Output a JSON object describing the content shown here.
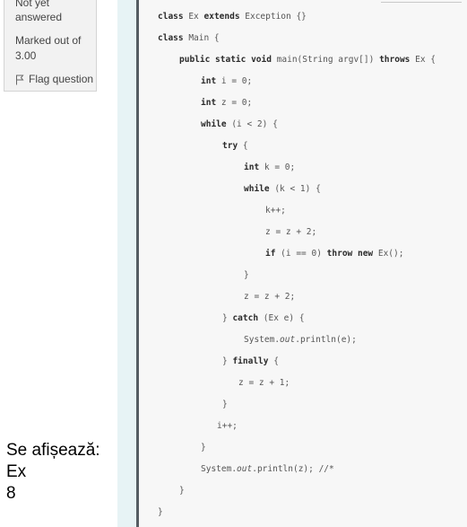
{
  "sidebar": {
    "status_line1": "Not yet",
    "status_line2": "answered",
    "marked_line1": "Marked out of",
    "marked_line2": "3.00",
    "flag_label": "Flag question",
    "flag_icon": "flag-icon"
  },
  "answer": {
    "line1": "Se afișează:",
    "line2": "Ex",
    "line3": "8"
  },
  "code": {
    "lines": [
      [
        {
          "t": "class",
          "k": 1
        },
        {
          "t": " Ex "
        },
        {
          "t": "extends",
          "k": 1
        },
        {
          "t": " Exception {}"
        }
      ],
      [
        {
          "t": "class",
          "k": 1
        },
        {
          "t": " Main {"
        }
      ],
      [
        {
          "t": "public static void",
          "k": 1
        },
        {
          "t": " main(String argv[]) "
        },
        {
          "t": "throws",
          "k": 1
        },
        {
          "t": " Ex {"
        }
      ],
      [
        {
          "t": "int",
          "k": 1
        },
        {
          "t": " i = 0;"
        }
      ],
      [
        {
          "t": "int",
          "k": 1
        },
        {
          "t": " z = 0;"
        }
      ],
      [
        {
          "t": "while",
          "k": 1
        },
        {
          "t": " (i < 2) {"
        }
      ],
      [
        {
          "t": "try",
          "k": 1
        },
        {
          "t": " {"
        }
      ],
      [
        {
          "t": "int",
          "k": 1
        },
        {
          "t": " k = 0;"
        }
      ],
      [
        {
          "t": "while",
          "k": 1
        },
        {
          "t": " (k < 1) {"
        }
      ],
      [
        {
          "t": "k++;"
        }
      ],
      [
        {
          "t": "z = z + 2;"
        }
      ],
      [
        {
          "t": "if",
          "k": 1
        },
        {
          "t": " (i == 0) "
        },
        {
          "t": "throw new",
          "k": 1
        },
        {
          "t": " Ex();"
        }
      ],
      [
        {
          "t": "}"
        }
      ],
      [
        {
          "t": "z = z + 2;"
        }
      ],
      [
        {
          "t": "} "
        },
        {
          "t": "catch",
          "k": 1
        },
        {
          "t": " (Ex e) {"
        }
      ],
      [
        {
          "t": "System."
        },
        {
          "t": "out",
          "i": 1
        },
        {
          "t": ".println(e);"
        }
      ],
      [
        {
          "t": "} "
        },
        {
          "t": "finally",
          "k": 1
        },
        {
          "t": " {"
        }
      ],
      [
        {
          "t": "z = z + 1;"
        }
      ],
      [
        {
          "t": "}"
        }
      ],
      [
        {
          "t": "i++;"
        }
      ],
      [
        {
          "t": "}"
        }
      ],
      [
        {
          "t": "System."
        },
        {
          "t": "out",
          "i": 1
        },
        {
          "t": ".println(z); //*"
        }
      ],
      [
        {
          "t": "}"
        }
      ],
      [
        {
          "t": "}"
        }
      ]
    ]
  }
}
